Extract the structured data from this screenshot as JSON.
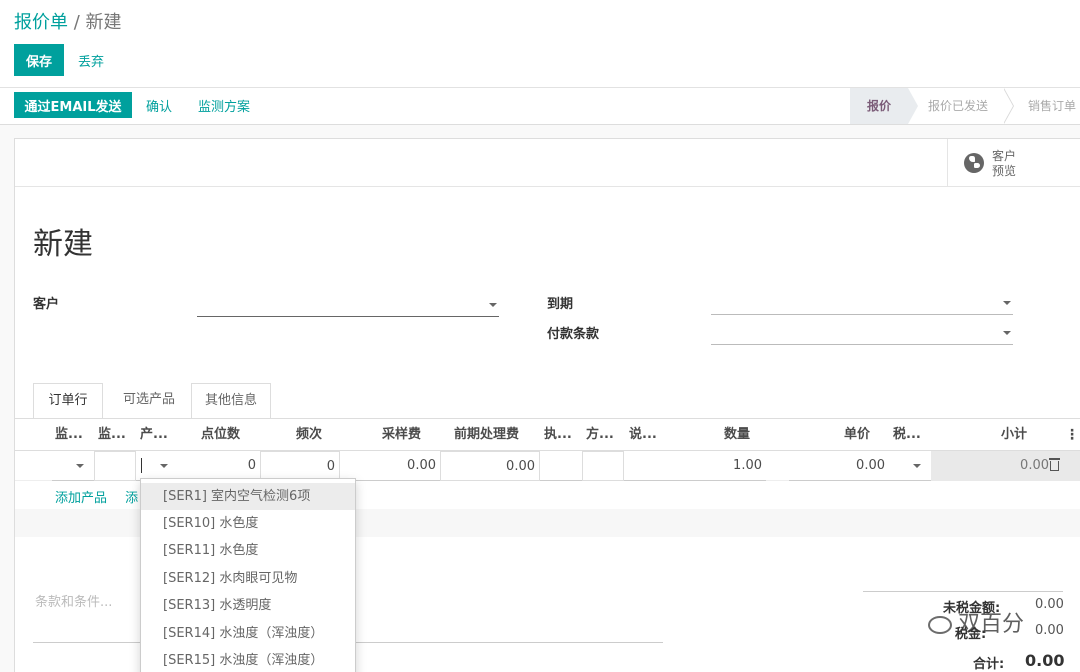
{
  "breadcrumb": {
    "parent": "报价单",
    "separator": "/",
    "current": "新建"
  },
  "actions": {
    "save": "保存",
    "discard": "丢弃"
  },
  "status_buttons": {
    "email": "通过EMAIL发送",
    "confirm": "确认",
    "plan": "监测方案"
  },
  "stages": [
    "报价",
    "报价已发送",
    "销售订单"
  ],
  "preview": {
    "line1": "客户",
    "line2": "预览"
  },
  "form": {
    "title": "新建",
    "customer_label": "客户",
    "expiry_label": "到期",
    "payment_label": "付款条款"
  },
  "tabs": [
    "订单行",
    "可选产品",
    "其他信息"
  ],
  "columns": [
    "监...",
    "监...",
    "产...",
    "点位数",
    "频次",
    "采样费",
    "前期处理费",
    "执...",
    "方...",
    "说...",
    "数量",
    "单价",
    "税...",
    "小计"
  ],
  "row": {
    "points": "0",
    "frequency": "0",
    "sampling_fee": "0.00",
    "pre_fee": "0.00",
    "quantity": "1.00",
    "unit_price": "0.00",
    "subtotal": "0.00"
  },
  "add_product": "添加产品",
  "add_partial": "添",
  "terms_placeholder": "条款和条件...",
  "totals": {
    "untaxed_label": "未税金额:",
    "untaxed_value": "0.00",
    "tax_label": "税金:",
    "tax_value": "0.00",
    "total_label": "合计:",
    "total_value": "0.00"
  },
  "dropdown_items": [
    "[SER1] 室内空气检测6项",
    "[SER10] 水色度",
    "[SER11] 水色度",
    "[SER12] 水肉眼可见物",
    "[SER13] 水透明度",
    "[SER14] 水浊度（浑浊度）",
    "[SER15] 水浊度（浑浊度）"
  ],
  "watermark": "双百分",
  "icons": {
    "preview": "globe-icon",
    "delete": "trash-icon",
    "caret": "caret-down-icon",
    "options": "kebab-icon",
    "watermark": "wechat-icon"
  },
  "colors": {
    "accent": "#00a09d",
    "active_stage": "#7b5c78"
  }
}
